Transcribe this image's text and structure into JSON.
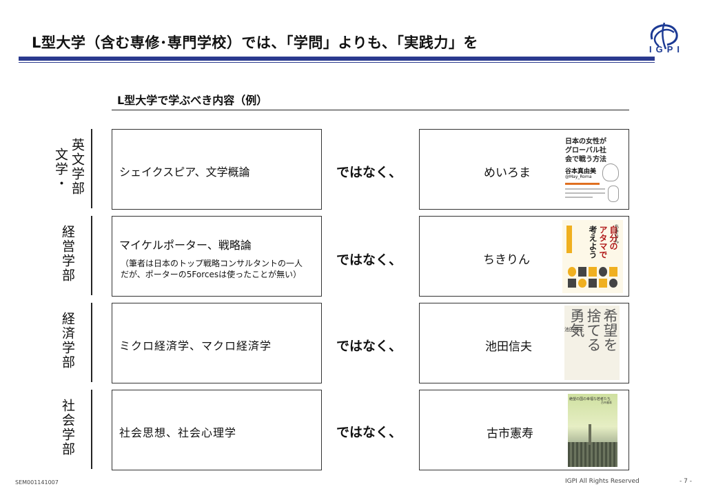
{
  "header": {
    "title": "L型大学（含む専修･専門学校）では、「学問」よりも、「実践力」を",
    "logo_text": "IGPI"
  },
  "section": {
    "title": "L型大学で学ぶべき内容（例）"
  },
  "rows": [
    {
      "department_cols": [
        "英文学部",
        "文学・"
      ],
      "subject": "シェイクスピア、文学概論",
      "note_lines": [],
      "connector": "ではなく、",
      "author": "めいろま",
      "book": {
        "title_lines": [
          "日本の女性が",
          "グローバル社",
          "会で戦う方法"
        ],
        "author": "谷本真由美",
        "handle": "@May_Roma"
      }
    },
    {
      "department_cols": [
        "経営学部"
      ],
      "subject": "マイケルポーター、戦略論",
      "note_lines": [
        "（筆者は日本のトップ戦略コンサルタントの一人",
        "だが、ポーターの5Forcesは使ったことが無い）"
      ],
      "connector": "ではなく、",
      "author": "ちきりん",
      "book": {
        "title_lines": [
          "自分の",
          "アタマで",
          "考えよう"
        ],
        "author": "ちきりん"
      }
    },
    {
      "department_cols": [
        "経済学部"
      ],
      "subject": "ミクロ経済学、マクロ経済学",
      "note_lines": [],
      "connector": "ではなく、",
      "author": "池田信夫",
      "book": {
        "title_lines": [
          "希望を",
          "捨てる",
          "勇気"
        ],
        "author": "池田信夫"
      }
    },
    {
      "department_cols": [
        "社会学部"
      ],
      "subject": "社会思想、社会心理学",
      "note_lines": [],
      "connector": "ではなく、",
      "author": "古市憲寿",
      "book": {
        "title_lines": [
          "絶望の国の幸福な若者たち"
        ],
        "author": "古市憲寿"
      }
    }
  ],
  "footer": {
    "doc_id": "SEM001141007",
    "rights": "IGPI All Rights Reserved",
    "page": "- 7 -"
  },
  "colors": {
    "accent": "#2b3a8f",
    "logo": "#1c3a94"
  }
}
